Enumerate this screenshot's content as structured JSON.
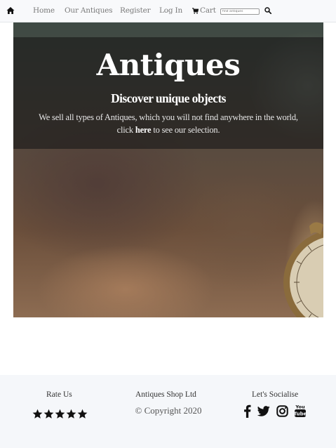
{
  "nav": {
    "home_icon": "home-icon",
    "links": [
      "Home",
      "Our Antiques",
      "Register",
      "Log In"
    ],
    "cart_label": "Cart",
    "cart_icon": "cart-icon",
    "search_placeholder": "find antiques",
    "search_icon": "search-icon"
  },
  "hero": {
    "title": "Antiques",
    "subtitle": "Discover unique objects",
    "desc_before": "We sell all types of Antiques, which you will not find anywhere in the world, click ",
    "desc_link": "here",
    "desc_after": " to see our selection."
  },
  "footer": {
    "rate_title": "Rate Us",
    "rating": 5,
    "rating_max": 5,
    "company": "Antiques Shop Ltd",
    "copyright": "© Copyright 2020",
    "social_title": "Let's Socialise",
    "social_icons": [
      "facebook-icon",
      "twitter-icon",
      "instagram-icon",
      "youtube-icon"
    ]
  },
  "colors": {
    "nav_bg": "#f8f9fb",
    "nav_text": "#7a7a7a",
    "overlay": "rgba(25,25,25,0.62)",
    "footer_bg": "#f5f7fa",
    "icon": "#111111"
  }
}
